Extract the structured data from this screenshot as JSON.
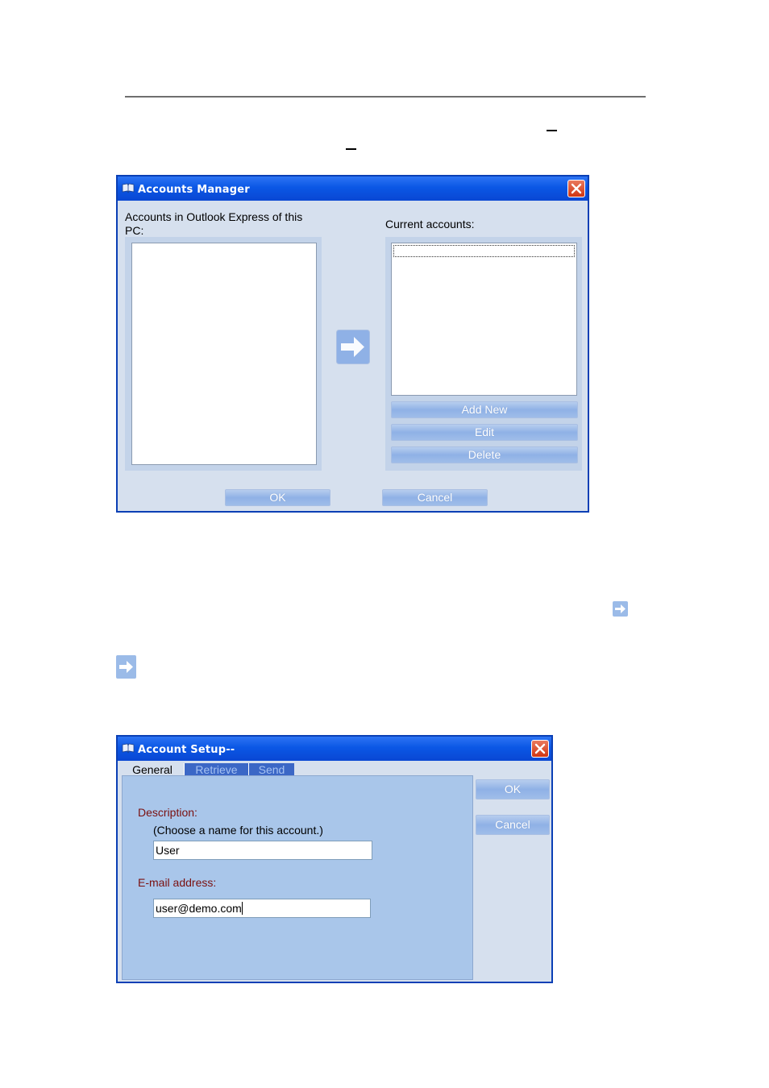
{
  "accounts_manager": {
    "title": "Accounts Manager",
    "left_label": "Accounts in Outlook Express of this PC:",
    "right_label": "Current accounts:",
    "buttons": {
      "add_new": "Add New",
      "edit": "Edit",
      "delete": "Delete",
      "ok": "OK",
      "cancel": "Cancel"
    },
    "icons": {
      "app": "book-icon",
      "close": "close-icon",
      "transfer": "arrow-right-icon"
    }
  },
  "account_setup": {
    "title": "Account Setup--",
    "tabs": [
      "General",
      "Retrieve",
      "Send"
    ],
    "active_tab": "General",
    "description_label": "Description:",
    "description_hint": "(Choose a name for this account.)",
    "description_value": "User",
    "email_label": "E-mail address:",
    "email_value": "user@demo.com",
    "buttons": {
      "ok": "OK",
      "cancel": "Cancel"
    }
  },
  "colors": {
    "title_bar": "#0b57e5",
    "window_bg": "#d6e0ee",
    "button_bg": "#8fb1e6",
    "label_red": "#7a1010"
  }
}
